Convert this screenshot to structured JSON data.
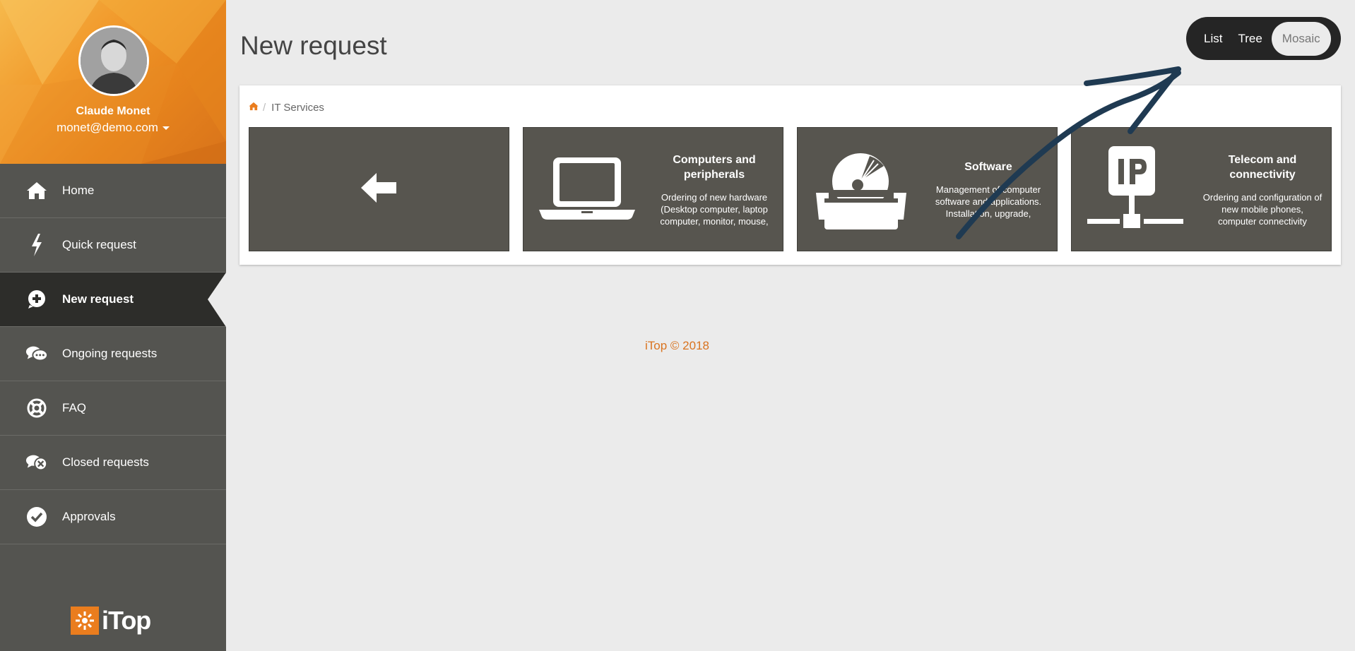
{
  "user": {
    "name": "Claude Monet",
    "email": "monet@demo.com"
  },
  "menu": {
    "items": [
      {
        "label": "Home",
        "icon": "home-icon"
      },
      {
        "label": "Quick request",
        "icon": "bolt-icon"
      },
      {
        "label": "New request",
        "icon": "plus-circle-icon",
        "active": true
      },
      {
        "label": "Ongoing requests",
        "icon": "chat-bubbles-icon"
      },
      {
        "label": "FAQ",
        "icon": "lifebuoy-icon"
      },
      {
        "label": "Closed requests",
        "icon": "chat-closed-icon"
      },
      {
        "label": "Approvals",
        "icon": "check-circle-icon"
      }
    ]
  },
  "logo": {
    "text": "iTop"
  },
  "page": {
    "title": "New request"
  },
  "view_switch": {
    "list": "List",
    "tree": "Tree",
    "mosaic": "Mosaic",
    "selected": "Mosaic"
  },
  "breadcrumb": {
    "home_icon": "home-icon",
    "current": "IT Services",
    "separator": "/"
  },
  "tiles": [
    {
      "kind": "back",
      "icon": "arrow-left-icon"
    },
    {
      "title": "Computers and peripherals",
      "desc": "Ordering of new hardware (Desktop computer, laptop computer, monitor, mouse,",
      "icon": "laptop-icon"
    },
    {
      "title": "Software",
      "desc": "Management of computer software and applications. Installation, upgrade,",
      "icon": "software-box-icon"
    },
    {
      "title": "Telecom and connectivity",
      "desc": "Ordering and configuration of new mobile phones, computer connectivity",
      "icon": "ip-network-icon"
    }
  ],
  "footer": {
    "text": "iTop © 2018"
  },
  "colors": {
    "accent": "#ea7d1e",
    "sidebar": "#545450",
    "tile": "#57554f",
    "active_menu": "#2d2d2a",
    "annotation_arrow": "#1f3a52"
  }
}
